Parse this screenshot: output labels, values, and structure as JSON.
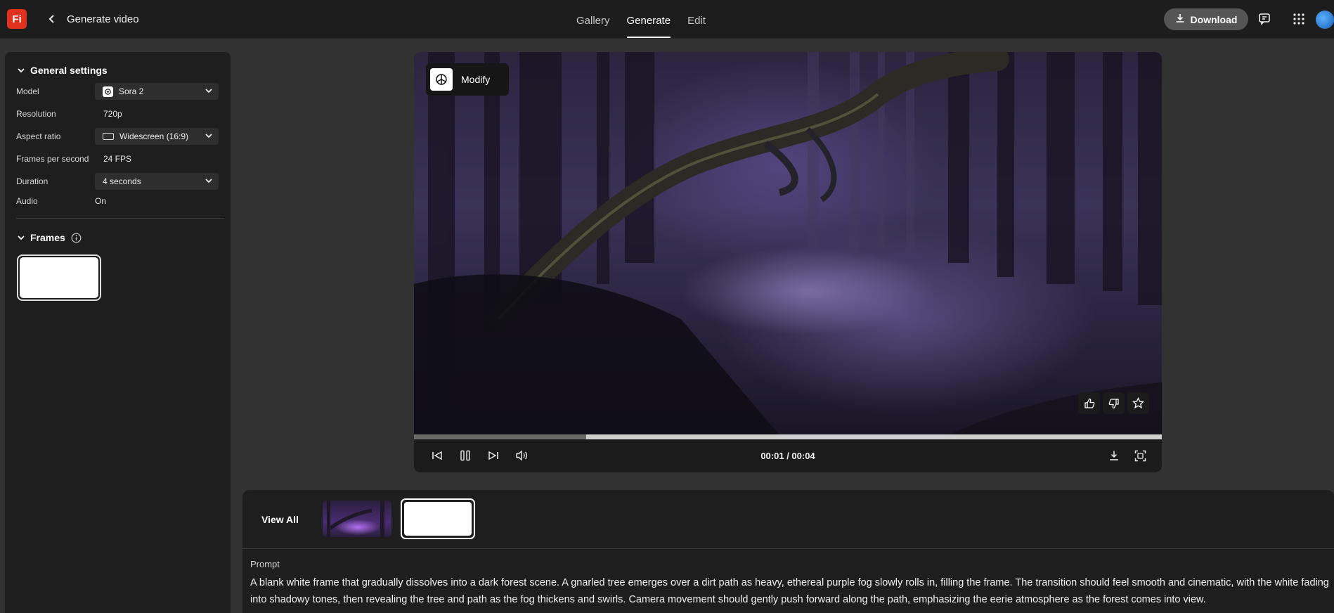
{
  "header": {
    "logo_text": "Fi",
    "title": "Generate video",
    "tabs": [
      {
        "label": "Gallery",
        "active": false
      },
      {
        "label": "Generate",
        "active": true
      },
      {
        "label": "Edit",
        "active": false
      }
    ],
    "download_label": "Download",
    "icons": [
      "chevron-left-icon",
      "download-icon",
      "comment-icon",
      "apps-grid-icon"
    ]
  },
  "sidebar": {
    "general_title": "General settings",
    "settings": {
      "model_label": "Model",
      "model_value": "Sora 2",
      "resolution_label": "Resolution",
      "resolution_value": "720p",
      "aspect_label": "Aspect ratio",
      "aspect_value": "Widescreen (16:9)",
      "fps_label": "Frames per second",
      "fps_value": "24 FPS",
      "duration_label": "Duration",
      "duration_value": "4 seconds",
      "audio_label": "Audio",
      "audio_value": "On"
    },
    "frames_title": "Frames"
  },
  "player": {
    "modify_label": "Modify",
    "time": "00:01 / 00:04",
    "progress": 0.23,
    "icons": [
      "openai-icon",
      "thumbs-up-icon",
      "thumbs-down-icon",
      "star-icon",
      "skip-back-icon",
      "pause-icon",
      "skip-forward-icon",
      "volume-icon",
      "download-icon",
      "fullscreen-icon"
    ]
  },
  "bottom": {
    "view_all_label": "View All",
    "prompt_label": "Prompt",
    "prompt_text": "A blank white frame that gradually dissolves into a dark forest scene. A gnarled tree emerges over a dirt path as heavy, ethereal purple fog slowly rolls in, filling the frame. The transition should feel smooth and cinematic, with the white fading into shadowy tones, then revealing the tree and path as the fog thickens and swirls. Camera movement should gently push forward along the path, emphasizing the eerie atmosphere as the forest comes into view."
  },
  "colors": {
    "logo_red": "#e0301e",
    "background": "#323232",
    "panel": "#1e1e1e",
    "fog_purple": "#8a78c8"
  }
}
